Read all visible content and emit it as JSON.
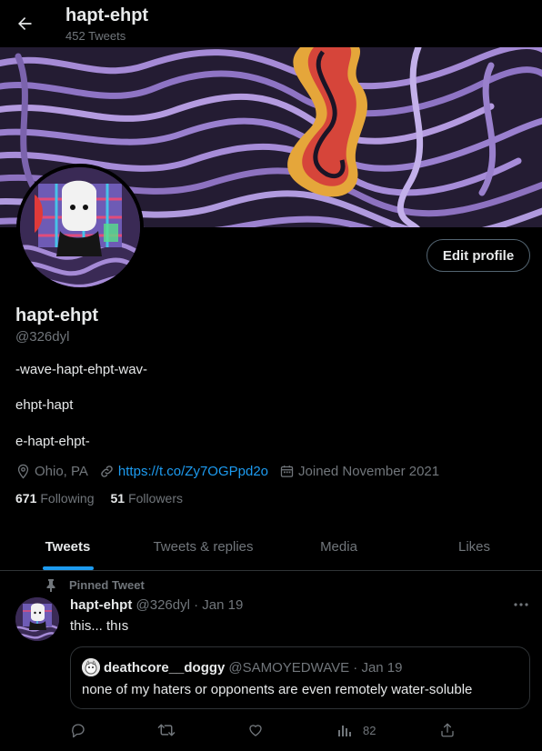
{
  "header": {
    "title": "hapt-ehpt",
    "subtitle": "452 Tweets"
  },
  "profile": {
    "edit_label": "Edit profile",
    "name": "hapt-ehpt",
    "handle": "@326dyl",
    "bio": [
      "-wave-hapt-ehpt-wav-",
      "ehpt-hapt",
      "e-hapt-ehpt-"
    ],
    "location": "Ohio, PA",
    "link": "https://t.co/Zy7OGPpd2o",
    "joined": "Joined November 2021",
    "following_count": "671",
    "following_label": "Following",
    "followers_count": "51",
    "followers_label": "Followers"
  },
  "tabs": [
    {
      "label": "Tweets"
    },
    {
      "label": "Tweets & replies"
    },
    {
      "label": "Media"
    },
    {
      "label": "Likes"
    }
  ],
  "tweet": {
    "pinned_label": "Pinned Tweet",
    "author_name": "hapt-ehpt",
    "author_meta": "@326dyl · Jan 19",
    "text": "this... thıs",
    "quote": {
      "author_name": "deathcore__doggy",
      "author_meta": "@SAMOYEDWAVE · Jan 19",
      "text": "none of my haters or opponents are even remotely water-soluble"
    },
    "views": "82"
  },
  "icons": {
    "back": "arrow-left-icon",
    "location": "location-pin-icon",
    "link": "link-icon",
    "calendar": "calendar-icon",
    "pin": "pin-icon",
    "more": "more-dots-icon",
    "reply": "reply-icon",
    "retweet": "retweet-icon",
    "like": "heart-icon",
    "views": "analytics-icon",
    "share": "share-icon"
  },
  "colors": {
    "accent": "#1d9bf0",
    "muted": "#71767b",
    "border": "#2f3336",
    "background": "#000000"
  }
}
